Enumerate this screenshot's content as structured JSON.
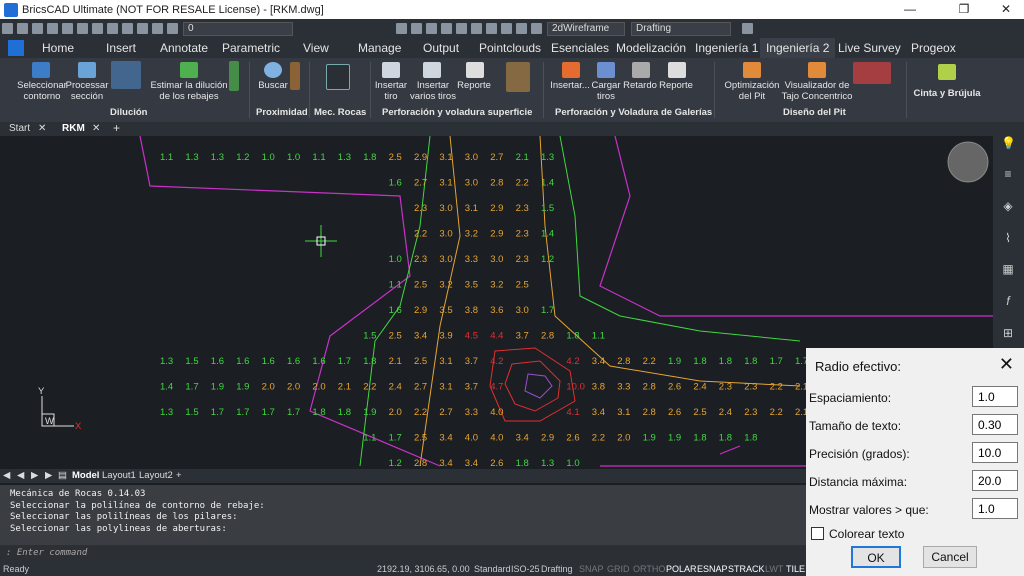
{
  "window": {
    "title": "BricsCAD Ultimate (NOT FOR RESALE License) - [RKM.dwg]",
    "minimize": "—",
    "restore": "❐",
    "close": "✕"
  },
  "qat": {
    "layer": "0",
    "visualstyle": "2dWireframe",
    "workspace": "Drafting"
  },
  "ribbon_tabs": [
    "Home",
    "Insert",
    "Annotate",
    "Parametric",
    "View",
    "Manage",
    "Output",
    "Pointclouds",
    "Esenciales",
    "Modelización",
    "Ingeniería 1",
    "Ingeniería 2",
    "Live Survey",
    "Progeox"
  ],
  "ribbon": {
    "buttons": [
      "Seleccionar\ncontorno",
      "Processar\nsección",
      "Estimar la dilución\nde los rebajes",
      "Buscar",
      "Insertar\ntiro",
      "Insertar\nvarios tiros",
      "Reporte",
      "Insertar...",
      "Cargar\ntiros",
      "Retardo",
      "Reporte",
      "Optimización\ndel Pit",
      "Visualizador de\nTajo Concentrico",
      "Cinta y Brújula"
    ],
    "groups": [
      "Dilución",
      "Proximidad",
      "Mec. Rocas",
      "Perforación y voladura superficie",
      "Perforación y Voladura de Galerías",
      "Diseño del Pit"
    ]
  },
  "doc_tabs": {
    "start": "Start",
    "rkm": "RKM",
    "add": "+"
  },
  "layout_tabs": {
    "model": "Model",
    "layout1": "Layout1",
    "layout2": "Layout2",
    "add": "+"
  },
  "grid_rows": [
    {
      "cells": [
        [
          "1.1",
          "g"
        ],
        [
          "1.3",
          "g"
        ],
        [
          "1.3",
          "g"
        ],
        [
          "1.2",
          "g"
        ],
        [
          "1.0",
          "g"
        ],
        [
          "1.0",
          "g"
        ],
        [
          "1.1",
          "g"
        ],
        [
          "1.3",
          "g"
        ],
        [
          "1.8",
          "g"
        ],
        [
          "2.5",
          "o"
        ],
        [
          "2.9",
          "o"
        ],
        [
          "3.1",
          "o"
        ],
        [
          "3.0",
          "o"
        ],
        [
          "2.7",
          "o"
        ],
        [
          "2.1",
          "g"
        ],
        [
          "1.3",
          "g"
        ]
      ],
      "start": 0
    },
    {
      "cells": [
        [
          "1.6",
          "g"
        ],
        [
          "2.7",
          "o"
        ],
        [
          "3.1",
          "o"
        ],
        [
          "3.0",
          "o"
        ],
        [
          "2.8",
          "o"
        ],
        [
          "2.2",
          "o"
        ],
        [
          "1.4",
          "g"
        ]
      ],
      "start": 9
    },
    {
      "cells": [
        [
          "2.3",
          "o"
        ],
        [
          "3.0",
          "o"
        ],
        [
          "3.1",
          "o"
        ],
        [
          "2.9",
          "o"
        ],
        [
          "2.3",
          "o"
        ],
        [
          "1.5",
          "g"
        ]
      ],
      "start": 10
    },
    {
      "cells": [
        [
          "2.2",
          "o"
        ],
        [
          "3.0",
          "o"
        ],
        [
          "3.2",
          "o"
        ],
        [
          "2.9",
          "o"
        ],
        [
          "2.3",
          "o"
        ],
        [
          "1.4",
          "g"
        ]
      ],
      "start": 10
    },
    {
      "cells": [
        [
          "1.0",
          "g"
        ],
        [
          "2.3",
          "o"
        ],
        [
          "3.0",
          "o"
        ],
        [
          "3.3",
          "o"
        ],
        [
          "3.0",
          "o"
        ],
        [
          "2.3",
          "o"
        ],
        [
          "1.2",
          "g"
        ]
      ],
      "start": 9
    },
    {
      "cells": [
        [
          "1.1",
          "g"
        ],
        [
          "2.5",
          "o"
        ],
        [
          "3.2",
          "o"
        ],
        [
          "3.5",
          "o"
        ],
        [
          "3.2",
          "o"
        ],
        [
          "2.5",
          "o"
        ]
      ],
      "start": 9
    },
    {
      "cells": [
        [
          "1.6",
          "g"
        ],
        [
          "2.9",
          "o"
        ],
        [
          "3.5",
          "o"
        ],
        [
          "3.8",
          "o"
        ],
        [
          "3.6",
          "o"
        ],
        [
          "3.0",
          "o"
        ],
        [
          "1.7",
          "g"
        ]
      ],
      "start": 9
    },
    {
      "cells": [
        [
          "1.5",
          "g"
        ],
        [
          "2.5",
          "o"
        ],
        [
          "3.4",
          "o"
        ],
        [
          "3.9",
          "o"
        ],
        [
          "4.5",
          "r"
        ],
        [
          "4.4",
          "r"
        ],
        [
          "3.7",
          "o"
        ],
        [
          "2.8",
          "o"
        ],
        [
          "1.8",
          "g"
        ],
        [
          "1.1",
          "g"
        ]
      ],
      "start": 8
    },
    {
      "cells": [
        [
          "1.3",
          "g"
        ],
        [
          "1.5",
          "g"
        ],
        [
          "1.6",
          "g"
        ],
        [
          "1.6",
          "g"
        ],
        [
          "1.6",
          "g"
        ],
        [
          "1.6",
          "g"
        ],
        [
          "1.6",
          "g"
        ],
        [
          "1.7",
          "g"
        ],
        [
          "1.8",
          "g"
        ],
        [
          "2.1",
          "o"
        ],
        [
          "2.5",
          "o"
        ],
        [
          "3.1",
          "o"
        ],
        [
          "3.7",
          "o"
        ],
        [
          "4.2",
          "r"
        ],
        [
          "",
          "g"
        ],
        [
          "",
          "g"
        ],
        [
          "4.2",
          "r"
        ],
        [
          "3.4",
          "o"
        ],
        [
          "2.8",
          "o"
        ],
        [
          "2.2",
          "o"
        ],
        [
          "1.9",
          "g"
        ],
        [
          "1.8",
          "g"
        ],
        [
          "1.8",
          "g"
        ],
        [
          "1.8",
          "g"
        ],
        [
          "1.7",
          "g"
        ],
        [
          "1.7",
          "g"
        ]
      ],
      "start": 0
    },
    {
      "cells": [
        [
          "1.4",
          "g"
        ],
        [
          "1.7",
          "g"
        ],
        [
          "1.9",
          "g"
        ],
        [
          "1.9",
          "g"
        ],
        [
          "2.0",
          "o"
        ],
        [
          "2.0",
          "o"
        ],
        [
          "2.0",
          "o"
        ],
        [
          "2.1",
          "o"
        ],
        [
          "2.2",
          "o"
        ],
        [
          "2.4",
          "o"
        ],
        [
          "2.7",
          "o"
        ],
        [
          "3.1",
          "o"
        ],
        [
          "3.7",
          "o"
        ],
        [
          "4.7",
          "r"
        ],
        [
          "",
          "g"
        ],
        [
          "",
          "g"
        ],
        [
          "10.0",
          "r"
        ],
        [
          "3.8",
          "o"
        ],
        [
          "3.3",
          "o"
        ],
        [
          "2.8",
          "o"
        ],
        [
          "2.6",
          "o"
        ],
        [
          "2.4",
          "o"
        ],
        [
          "2.3",
          "o"
        ],
        [
          "2.3",
          "o"
        ],
        [
          "2.2",
          "o"
        ],
        [
          "2.1",
          "o"
        ]
      ],
      "start": 0
    },
    {
      "cells": [
        [
          "1.3",
          "g"
        ],
        [
          "1.5",
          "g"
        ],
        [
          "1.7",
          "g"
        ],
        [
          "1.7",
          "g"
        ],
        [
          "1.7",
          "g"
        ],
        [
          "1.7",
          "g"
        ],
        [
          "1.8",
          "g"
        ],
        [
          "1.8",
          "g"
        ],
        [
          "1.9",
          "g"
        ],
        [
          "2.0",
          "o"
        ],
        [
          "2.2",
          "o"
        ],
        [
          "2.7",
          "o"
        ],
        [
          "3.3",
          "o"
        ],
        [
          "4.0",
          "o"
        ],
        [
          "",
          "g"
        ],
        [
          "",
          "g"
        ],
        [
          "4.1",
          "r"
        ],
        [
          "3.4",
          "o"
        ],
        [
          "3.1",
          "o"
        ],
        [
          "2.8",
          "o"
        ],
        [
          "2.6",
          "o"
        ],
        [
          "2.5",
          "o"
        ],
        [
          "2.4",
          "o"
        ],
        [
          "2.3",
          "o"
        ],
        [
          "2.2",
          "o"
        ],
        [
          "2.1",
          "o"
        ]
      ],
      "start": 0
    },
    {
      "cells": [
        [
          "1.1",
          "g"
        ],
        [
          "1.7",
          "g"
        ],
        [
          "2.5",
          "o"
        ],
        [
          "3.4",
          "o"
        ],
        [
          "4.0",
          "o"
        ],
        [
          "4.0",
          "o"
        ],
        [
          "3.4",
          "o"
        ],
        [
          "2.9",
          "o"
        ],
        [
          "2.6",
          "o"
        ],
        [
          "2.2",
          "o"
        ],
        [
          "2.0",
          "o"
        ],
        [
          "1.9",
          "g"
        ],
        [
          "1.9",
          "g"
        ],
        [
          "1.8",
          "g"
        ],
        [
          "1.8",
          "g"
        ],
        [
          "1.8",
          "g"
        ]
      ],
      "start": 8
    },
    {
      "cells": [
        [
          "1.2",
          "g"
        ],
        [
          "2.8",
          "o"
        ],
        [
          "3.4",
          "o"
        ],
        [
          "3.4",
          "o"
        ],
        [
          "2.6",
          "o"
        ],
        [
          "1.8",
          "g"
        ],
        [
          "1.3",
          "g"
        ],
        [
          "1.0",
          "g"
        ]
      ],
      "start": 9
    }
  ],
  "command_lines": [
    "Mecánica de Rocas 0.14.03",
    "Seleccionar la polilínea de contorno de rebaje:",
    "Seleccionar las polilíneas de los pilares:",
    "Seleccionar las polylineas de aberturas:"
  ],
  "command_prompt": ": Enter command",
  "status": {
    "ready": "Ready",
    "coords": "2192.19, 3106.65, 0.00",
    "style": "Standard",
    "dimstyle": "ISO-25",
    "ws": "Drafting",
    "toggles": [
      "SNAP",
      "GRID",
      "ORTHO",
      "POLAR",
      "ESNAP",
      "STRACK",
      "LWT",
      "TILE"
    ]
  },
  "dialog": {
    "title": "Radio efectivo:",
    "close": "✕",
    "fields": [
      {
        "label": "Espaciamiento:",
        "value": "1.0"
      },
      {
        "label": "Tamaño de texto:",
        "value": "0.30"
      },
      {
        "label": "Precisión (grados):",
        "value": "10.0"
      },
      {
        "label": "Distancia máxima:",
        "value": "20.0"
      },
      {
        "label": "Mostrar valores > que:",
        "value": "1.0"
      }
    ],
    "checkbox": "Colorear texto",
    "ok": "OK",
    "cancel": "Cancel"
  },
  "ucs": {
    "x": "X",
    "y": "Y",
    "w": "W"
  },
  "colors": {
    "green": "#41d941",
    "orange": "#e6a532",
    "red": "#e03030",
    "magenta": "#c832c8"
  }
}
